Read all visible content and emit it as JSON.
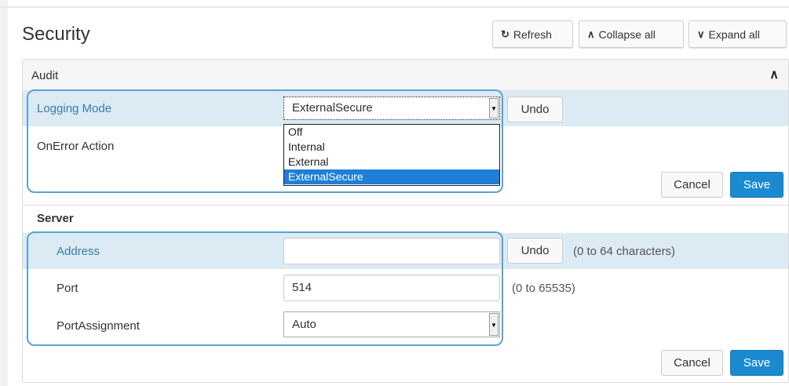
{
  "page": {
    "title": "Security"
  },
  "toolbar": {
    "refresh_label": "Refresh",
    "collapse_label": "Collapse all",
    "expand_label": "Expand all"
  },
  "audit": {
    "header": "Audit",
    "logging_mode": {
      "label": "Logging Mode",
      "value": "ExternalSecure",
      "undo_label": "Undo",
      "options": [
        "Off",
        "Internal",
        "External",
        "ExternalSecure"
      ],
      "selected_option": "ExternalSecure"
    },
    "onerror": {
      "label": "OnError Action"
    },
    "cancel_label": "Cancel",
    "save_label": "Save"
  },
  "server": {
    "title": "Server",
    "address": {
      "label": "Address",
      "value": "",
      "undo_label": "Undo",
      "hint": "(0 to 64 characters)"
    },
    "port": {
      "label": "Port",
      "value": "514",
      "hint": "(0 to 65535)"
    },
    "port_assignment": {
      "label": "PortAssignment",
      "value": "Auto"
    },
    "cancel_label": "Cancel",
    "save_label": "Save"
  },
  "colors": {
    "accent": "#1a8bd1",
    "focus": "#5aa3d2",
    "highlight_row": "#dbeaf3",
    "selected_option": "#1e7fd8"
  }
}
